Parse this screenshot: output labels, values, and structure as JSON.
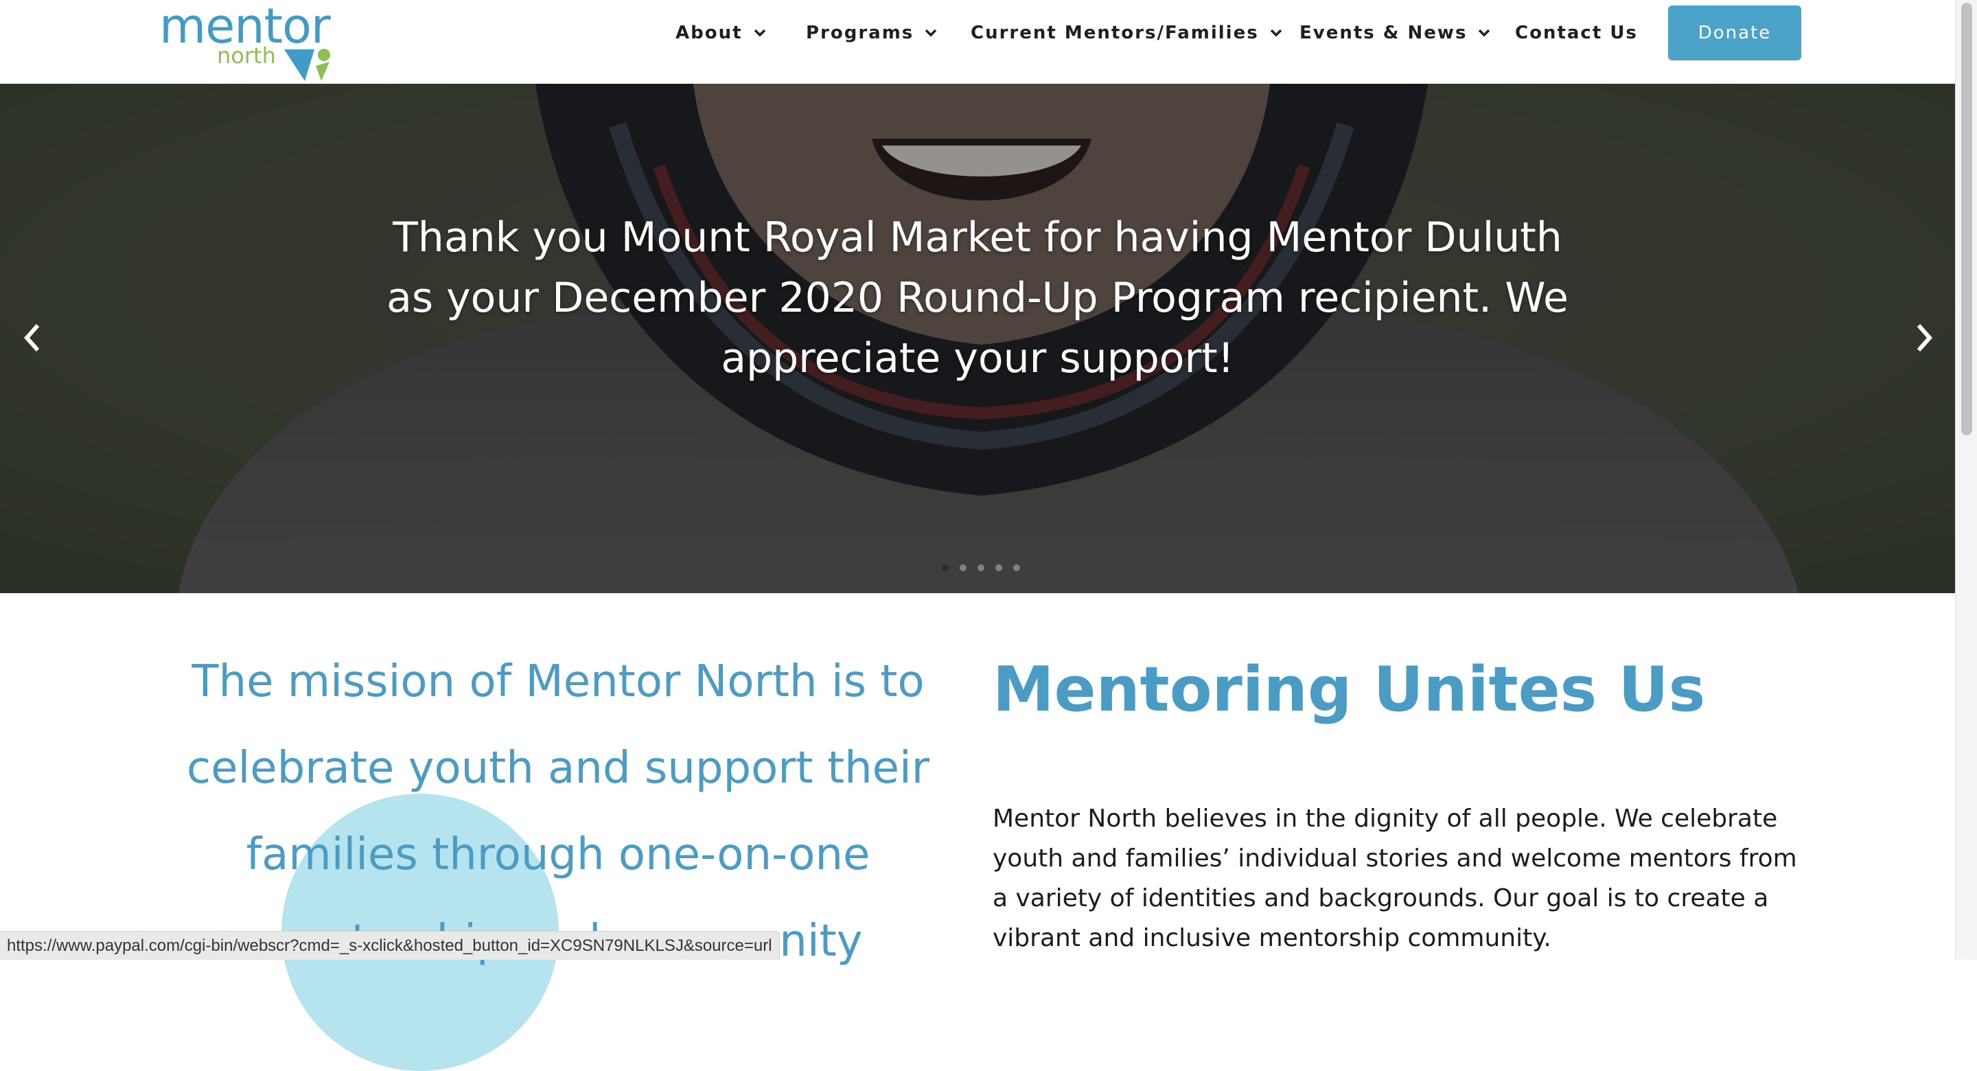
{
  "header": {
    "logo": {
      "word_top": "mentor",
      "word_bottom": "north",
      "color_primary": "#3f9cc6",
      "color_secondary": "#8cc152"
    },
    "nav": [
      {
        "label": "About",
        "has_dropdown": true
      },
      {
        "label": "Programs",
        "has_dropdown": true
      },
      {
        "label": "Current Mentors/Families",
        "has_dropdown": true
      },
      {
        "label": "Events & News",
        "has_dropdown": true
      },
      {
        "label": "Contact Us",
        "has_dropdown": false
      }
    ],
    "donate_label": "Donate",
    "donate_color": "#4ba3c9"
  },
  "hero": {
    "slide_text": "Thank you Mount Royal Market for having Mentor Duluth as your December 2020 Round-Up Program recipient.  We appreciate your support!",
    "prev_icon": "chevron-left-icon",
    "next_icon": "chevron-right-icon",
    "slide_count": 5,
    "active_slide": 1
  },
  "content": {
    "mission_text": "The mission of Mentor North is to celebrate youth and support their families through one-on-one mentorship and community",
    "title": "Mentoring Unites Us",
    "body": "Mentor North believes in the dignity of all people. We celebrate youth and families’ individual stories and welcome mentors from a variety of identities and backgrounds. Our goal is to create a vibrant and inclusive mentorship community.",
    "accent_color": "#4a9cc4"
  },
  "status_bar": {
    "url": "https://www.paypal.com/cgi-bin/webscr?cmd=_s-xclick&hosted_button_id=XC9SN79NLKLSJ&source=url"
  }
}
